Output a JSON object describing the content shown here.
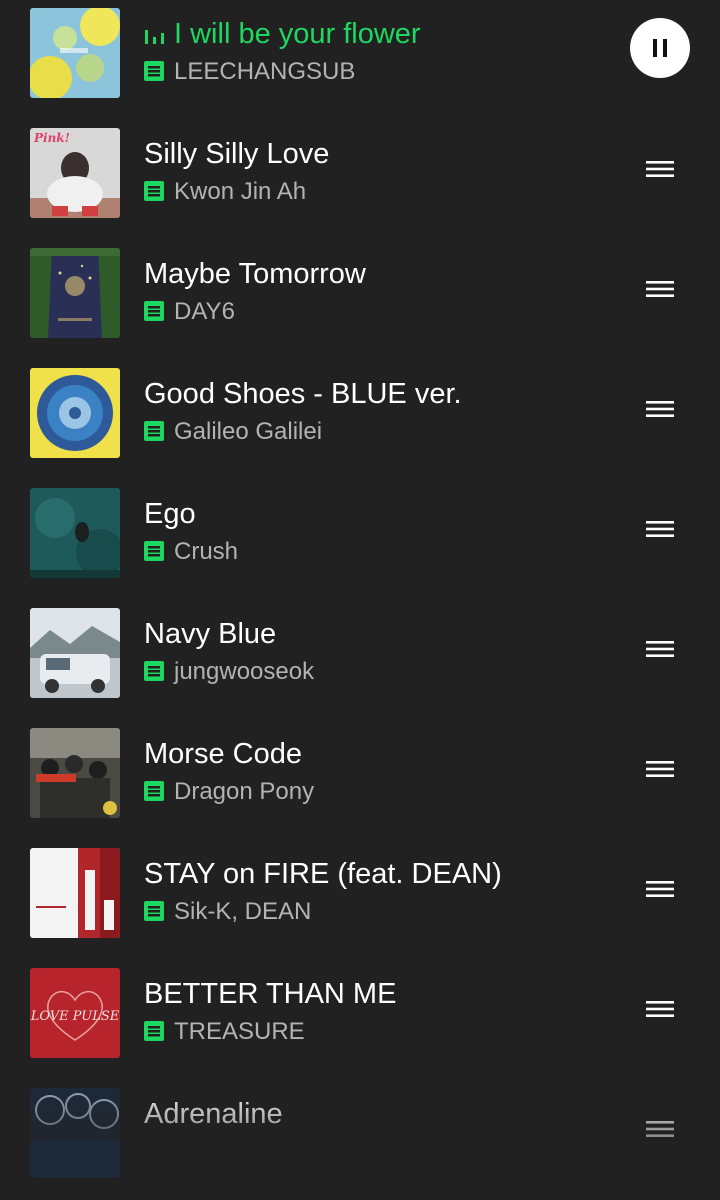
{
  "now_playing": {
    "title": "I will be your flower",
    "artist": "LEECHANGSUB",
    "state": "playing"
  },
  "queue": [
    {
      "title": "Silly Silly Love",
      "artist": "Kwon Jin Ah",
      "art_label": "Pink!"
    },
    {
      "title": "Maybe Tomorrow",
      "artist": "DAY6"
    },
    {
      "title": "Good Shoes - BLUE ver.",
      "artist": "Galileo Galilei"
    },
    {
      "title": "Ego",
      "artist": "Crush"
    },
    {
      "title": "Navy Blue",
      "artist": "jungwooseok"
    },
    {
      "title": "Morse Code",
      "artist": "Dragon Pony"
    },
    {
      "title": "STAY on FIRE (feat. DEAN)",
      "artist": "Sik-K, DEAN"
    },
    {
      "title": "BETTER THAN ME",
      "artist": "TREASURE",
      "art_label": "LOVE PULSE"
    },
    {
      "title": "Adrenaline",
      "artist": ""
    }
  ],
  "icons": {
    "downloaded": "downloaded-icon",
    "reorder": "drag-handle-icon",
    "pause": "pause-icon",
    "equalizer": "equalizer-icon"
  },
  "colors": {
    "background": "#212121",
    "accent": "#1ed760",
    "secondary_text": "#b3b3b3"
  }
}
